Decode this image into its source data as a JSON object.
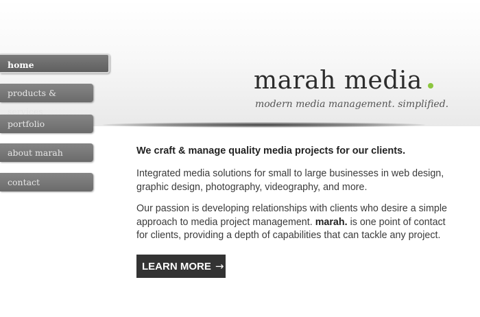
{
  "nav": {
    "items": [
      {
        "label": "home",
        "active": true
      },
      {
        "label": "products & services",
        "active": false
      },
      {
        "label": "portfolio",
        "active": false
      },
      {
        "label": "about marah",
        "active": false
      },
      {
        "label": "contact",
        "active": false
      }
    ]
  },
  "brand": {
    "name": "marah media",
    "tagline": "modern media management. simplified.",
    "dot_color": "#8cc63f"
  },
  "content": {
    "lead": "We craft & manage quality media projects for our clients.",
    "para1": "Integrated media solutions for small to large businesses in web design, graphic design, photography, videography, and more.",
    "para2_before": "Our passion is developing relationships with clients who desire a simple approach to media project management.",
    "para2_brand": "marah.",
    "para2_after": "is one point of contact for clients, providing a depth of capabilities that can tackle any project."
  },
  "cta": {
    "label": "LEARN MORE",
    "arrow": "→"
  }
}
